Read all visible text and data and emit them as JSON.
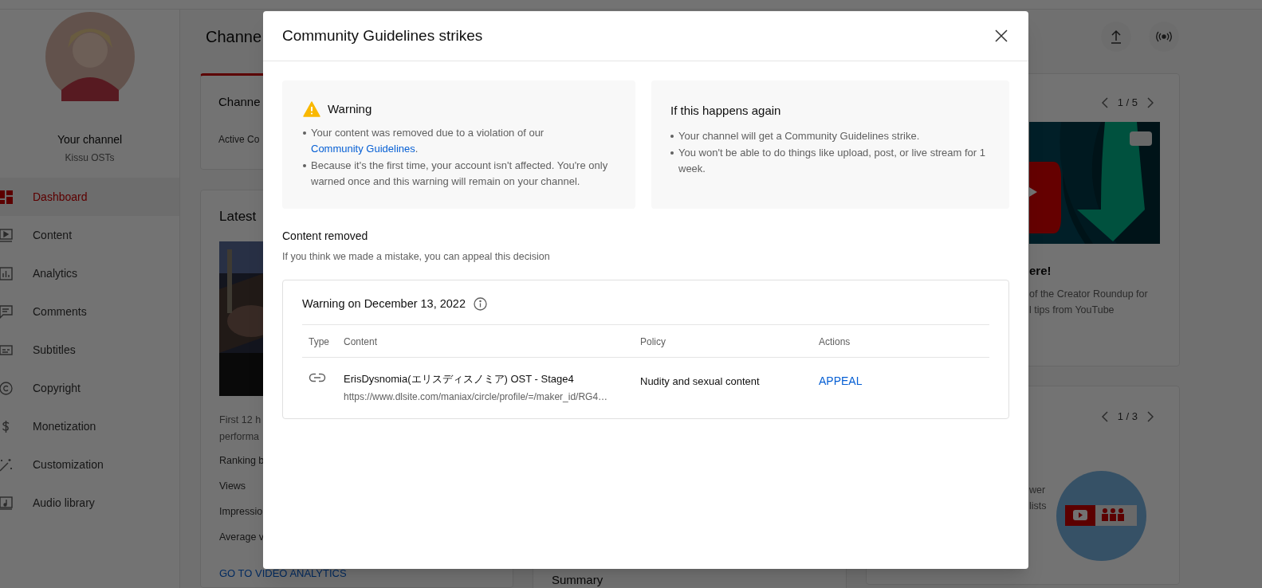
{
  "sidebar": {
    "channel_title": "Your channel",
    "channel_name": "Kissu OSTs",
    "items": [
      {
        "label": "Dashboard",
        "selected": true
      },
      {
        "label": "Content",
        "selected": false
      },
      {
        "label": "Analytics",
        "selected": false
      },
      {
        "label": "Comments",
        "selected": false
      },
      {
        "label": "Subtitles",
        "selected": false
      },
      {
        "label": "Copyright",
        "selected": false
      },
      {
        "label": "Monetization",
        "selected": false
      },
      {
        "label": "Customization",
        "selected": false
      },
      {
        "label": "Audio library",
        "selected": false
      }
    ]
  },
  "dashboard": {
    "title": "Channe",
    "channel_card": {
      "title": "Channe",
      "line": "Active Co"
    },
    "latest_card": {
      "title": "Latest",
      "lines": [
        "First 12 h",
        "performa"
      ],
      "metrics": [
        "Ranking b",
        "Views",
        "Impressio",
        "Average v"
      ],
      "link": "GO TO VIDEO ANALYTICS"
    },
    "summary_card": {
      "title": "Summary"
    },
    "news_card": {
      "pager": "1 / 5",
      "title": "ere!",
      "lines": [
        "of the Creator Roundup for",
        "l tips from YouTube"
      ]
    },
    "ideas_card": {
      "pager": "1 / 3",
      "lines": [
        "wer",
        "lists"
      ]
    }
  },
  "dialog": {
    "title": "Community Guidelines strikes",
    "warning": {
      "title": "Warning",
      "bullets": [
        {
          "text": "Your content was removed due to a violation of our ",
          "link": "Community Guidelines",
          "after": "."
        },
        {
          "text": "Because it's the first time, your account isn't affected. You're only warned once and this warning will remain on your channel."
        }
      ]
    },
    "again": {
      "title": "If this happens again",
      "bullets": [
        {
          "text": "Your channel will get a Community Guidelines strike."
        },
        {
          "text": "You won't be able to do things like upload, post, or live stream for 1 week."
        }
      ]
    },
    "section_title": "Content removed",
    "section_subtitle": "If you think we made a mistake, you can appeal this decision",
    "strike": {
      "title": "Warning on December 13, 2022",
      "columns": [
        "Type",
        "Content",
        "Policy",
        "Actions"
      ],
      "rows": [
        {
          "kind": "link",
          "content_title": "ErisDysnomia(エリスディスノミア) OST - Stage4",
          "content_url": "https://www.dlsite.com/maniax/circle/profile/=/maker_id/RG4…",
          "policy": "Nudity and sexual content",
          "action": "APPEAL"
        }
      ]
    }
  }
}
